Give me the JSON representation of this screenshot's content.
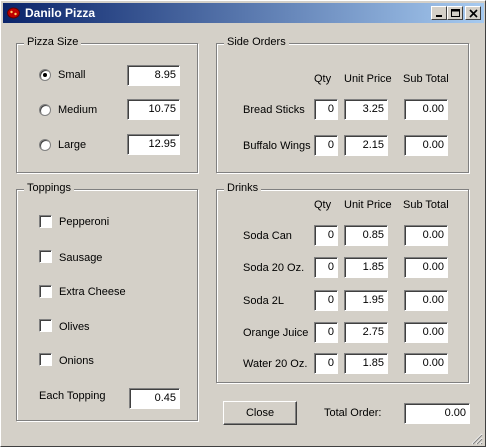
{
  "window": {
    "title": "Danilo Pizza"
  },
  "pizza_size": {
    "legend": "Pizza Size",
    "options": [
      {
        "label": "Small",
        "price": "8.95",
        "selected": true
      },
      {
        "label": "Medium",
        "price": "10.75",
        "selected": false
      },
      {
        "label": "Large",
        "price": "12.95",
        "selected": false
      }
    ]
  },
  "toppings": {
    "legend": "Toppings",
    "items": [
      "Pepperoni",
      "Sausage",
      "Extra Cheese",
      "Olives",
      "Onions"
    ],
    "each_label": "Each Topping",
    "each_price": "0.45"
  },
  "side_orders": {
    "legend": "Side Orders",
    "headers": {
      "qty": "Qty",
      "unit_price": "Unit Price",
      "sub_total": "Sub Total"
    },
    "rows": [
      {
        "label": "Bread Sticks",
        "qty": "0",
        "unit_price": "3.25",
        "sub_total": "0.00"
      },
      {
        "label": "Buffalo Wings",
        "qty": "0",
        "unit_price": "2.15",
        "sub_total": "0.00"
      }
    ]
  },
  "drinks": {
    "legend": "Drinks",
    "headers": {
      "qty": "Qty",
      "unit_price": "Unit Price",
      "sub_total": "Sub Total"
    },
    "rows": [
      {
        "label": "Soda Can",
        "qty": "0",
        "unit_price": "0.85",
        "sub_total": "0.00"
      },
      {
        "label": "Soda 20 Oz.",
        "qty": "0",
        "unit_price": "1.85",
        "sub_total": "0.00"
      },
      {
        "label": "Soda 2L",
        "qty": "0",
        "unit_price": "1.95",
        "sub_total": "0.00"
      },
      {
        "label": "Orange Juice",
        "qty": "0",
        "unit_price": "2.75",
        "sub_total": "0.00"
      },
      {
        "label": "Water 20 Oz.",
        "qty": "0",
        "unit_price": "1.85",
        "sub_total": "0.00"
      }
    ]
  },
  "footer": {
    "close_label": "Close",
    "total_label": "Total Order:",
    "total_value": "0.00"
  }
}
